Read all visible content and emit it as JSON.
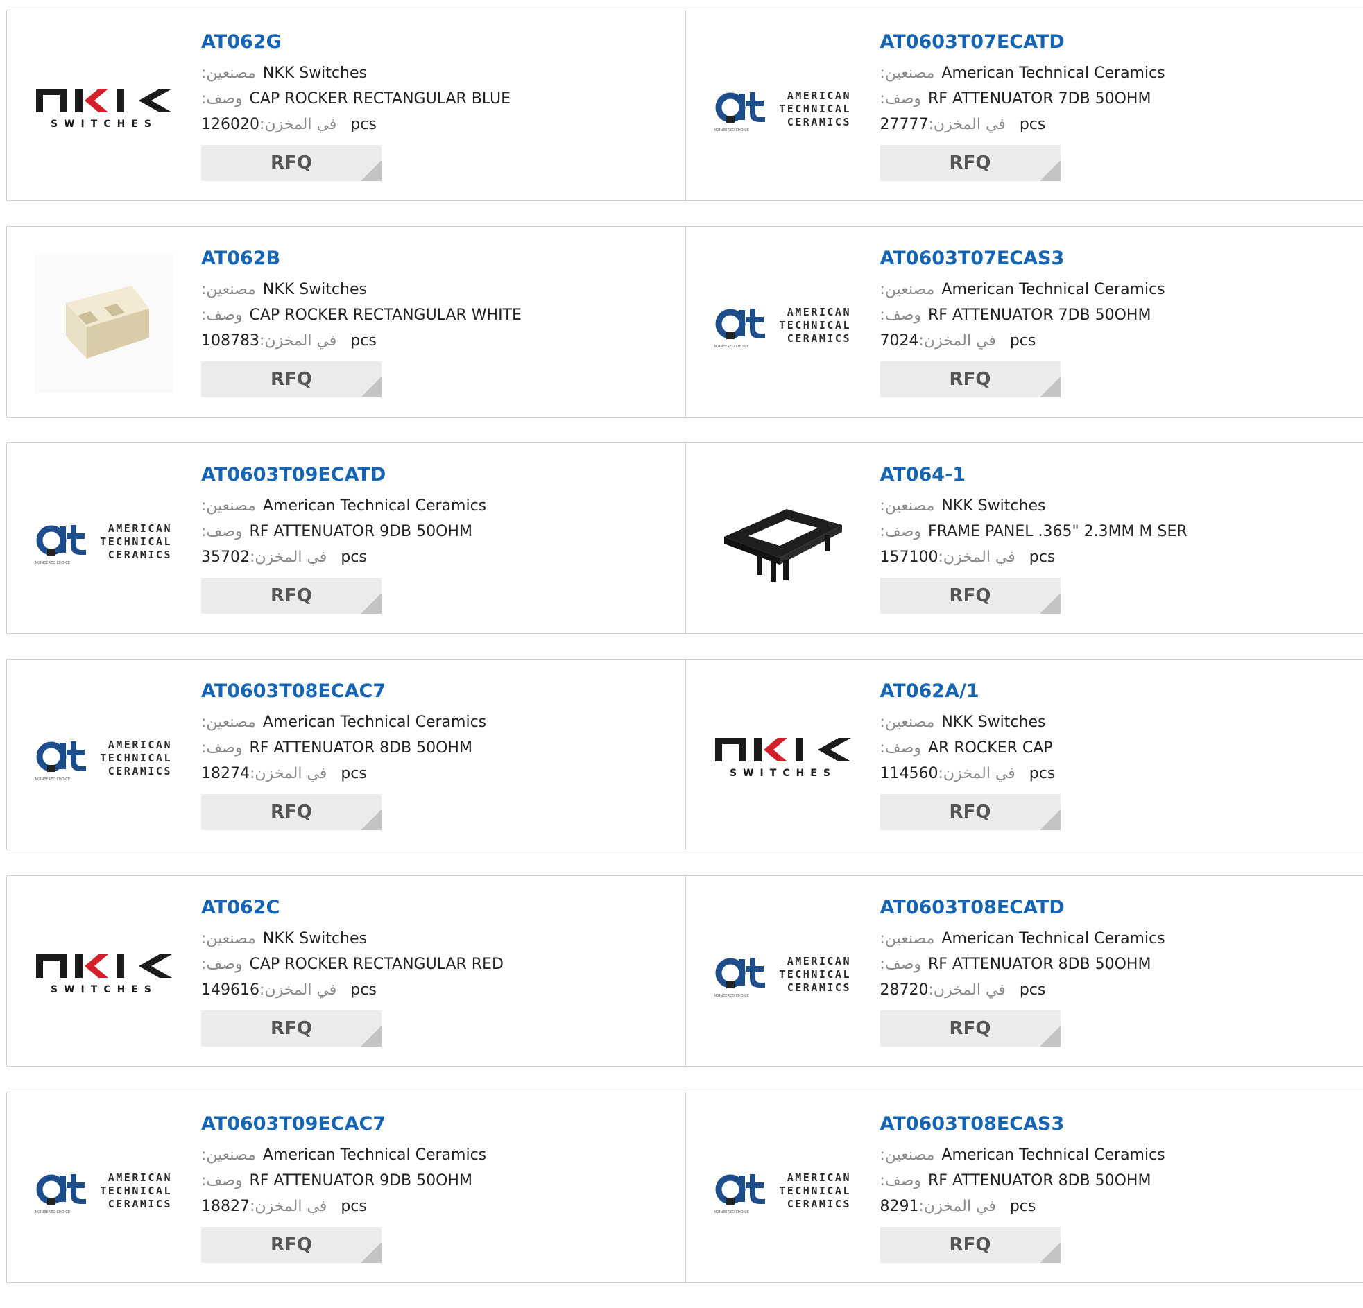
{
  "labels": {
    "manufacturer": ":مصنعين",
    "description": ":وصف",
    "stock": ":في المخزن",
    "unit": "pcs",
    "rfq": "RFQ"
  },
  "logos": {
    "nkk": {
      "main": "NKK",
      "sub": "SWITCHES"
    },
    "atc": {
      "line1": "AMERICAN",
      "line2": "TECHNICAL",
      "line3": "CERAMICS",
      "tag": "ENGINEERED CHOICE"
    }
  },
  "colors": {
    "link": "#1565b4",
    "atc_blue": "#1e4d8c",
    "rfq_bg": "#ececec"
  },
  "products": [
    {
      "part": "AT062G",
      "manufacturer": "NKK Switches",
      "description": "CAP ROCKER RECTANGULAR BLUE",
      "stock": "126020",
      "image": "nkk-logo"
    },
    {
      "part": "AT0603T07ECATD",
      "manufacturer": "American Technical Ceramics",
      "description": "RF ATTENUATOR 7DB 50OHM",
      "stock": "27777",
      "image": "atc-logo"
    },
    {
      "part": "AT062B",
      "manufacturer": "NKK Switches",
      "description": "CAP ROCKER RECTANGULAR WHITE",
      "stock": "108783",
      "image": "white-rocker-cap"
    },
    {
      "part": "AT0603T07ECAS3",
      "manufacturer": "American Technical Ceramics",
      "description": "RF ATTENUATOR 7DB 50OHM",
      "stock": "7024",
      "image": "atc-logo"
    },
    {
      "part": "AT0603T09ECATD",
      "manufacturer": "American Technical Ceramics",
      "description": "RF ATTENUATOR 9DB 50OHM",
      "stock": "35702",
      "image": "atc-logo"
    },
    {
      "part": "AT064-1",
      "manufacturer": "NKK Switches",
      "description": "FRAME PANEL .365\" 2.3MM M SER",
      "stock": "157100",
      "image": "black-frame-panel"
    },
    {
      "part": "AT0603T08ECAC7",
      "manufacturer": "American Technical Ceramics",
      "description": "RF ATTENUATOR 8DB 50OHM",
      "stock": "18274",
      "image": "atc-logo"
    },
    {
      "part": "AT062A/1",
      "manufacturer": "NKK Switches",
      "description": "AR ROCKER CAP",
      "stock": "114560",
      "image": "nkk-logo"
    },
    {
      "part": "AT062C",
      "manufacturer": "NKK Switches",
      "description": "CAP ROCKER RECTANGULAR RED",
      "stock": "149616",
      "image": "nkk-logo"
    },
    {
      "part": "AT0603T08ECATD",
      "manufacturer": "American Technical Ceramics",
      "description": "RF ATTENUATOR 8DB 50OHM",
      "stock": "28720",
      "image": "atc-logo"
    },
    {
      "part": "AT0603T09ECAC7",
      "manufacturer": "American Technical Ceramics",
      "description": "RF ATTENUATOR 9DB 50OHM",
      "stock": "18827",
      "image": "atc-logo"
    },
    {
      "part": "AT0603T08ECAS3",
      "manufacturer": "American Technical Ceramics",
      "description": "RF ATTENUATOR 8DB 50OHM",
      "stock": "8291",
      "image": "atc-logo"
    }
  ]
}
